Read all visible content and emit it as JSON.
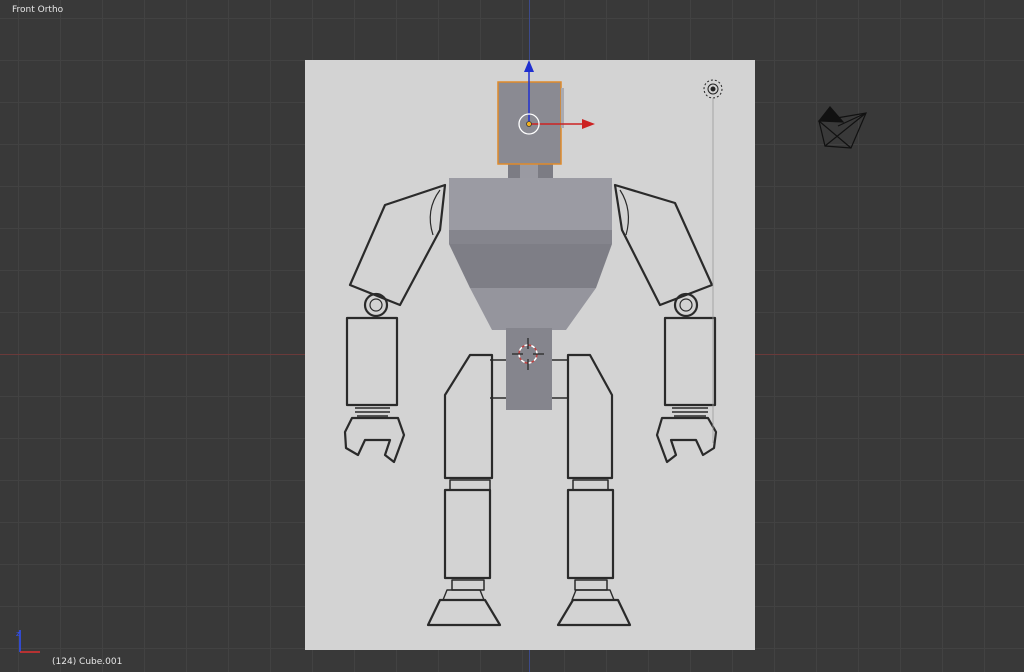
{
  "viewport": {
    "view_name": "Front Ortho",
    "object_info": "(124) Cube.001"
  },
  "colors": {
    "background": "#393939",
    "grid": "#424242",
    "reference_image": "#d3d3d3",
    "x_axis": "#cc2222",
    "z_axis": "#1f2fd0",
    "selection": "#e08a2a",
    "mesh": "#8e8e97"
  },
  "icons": {
    "lamp": "lamp-icon",
    "camera": "camera-icon",
    "cursor": "3d-cursor-icon",
    "axes": "axes-gizmo-icon"
  }
}
